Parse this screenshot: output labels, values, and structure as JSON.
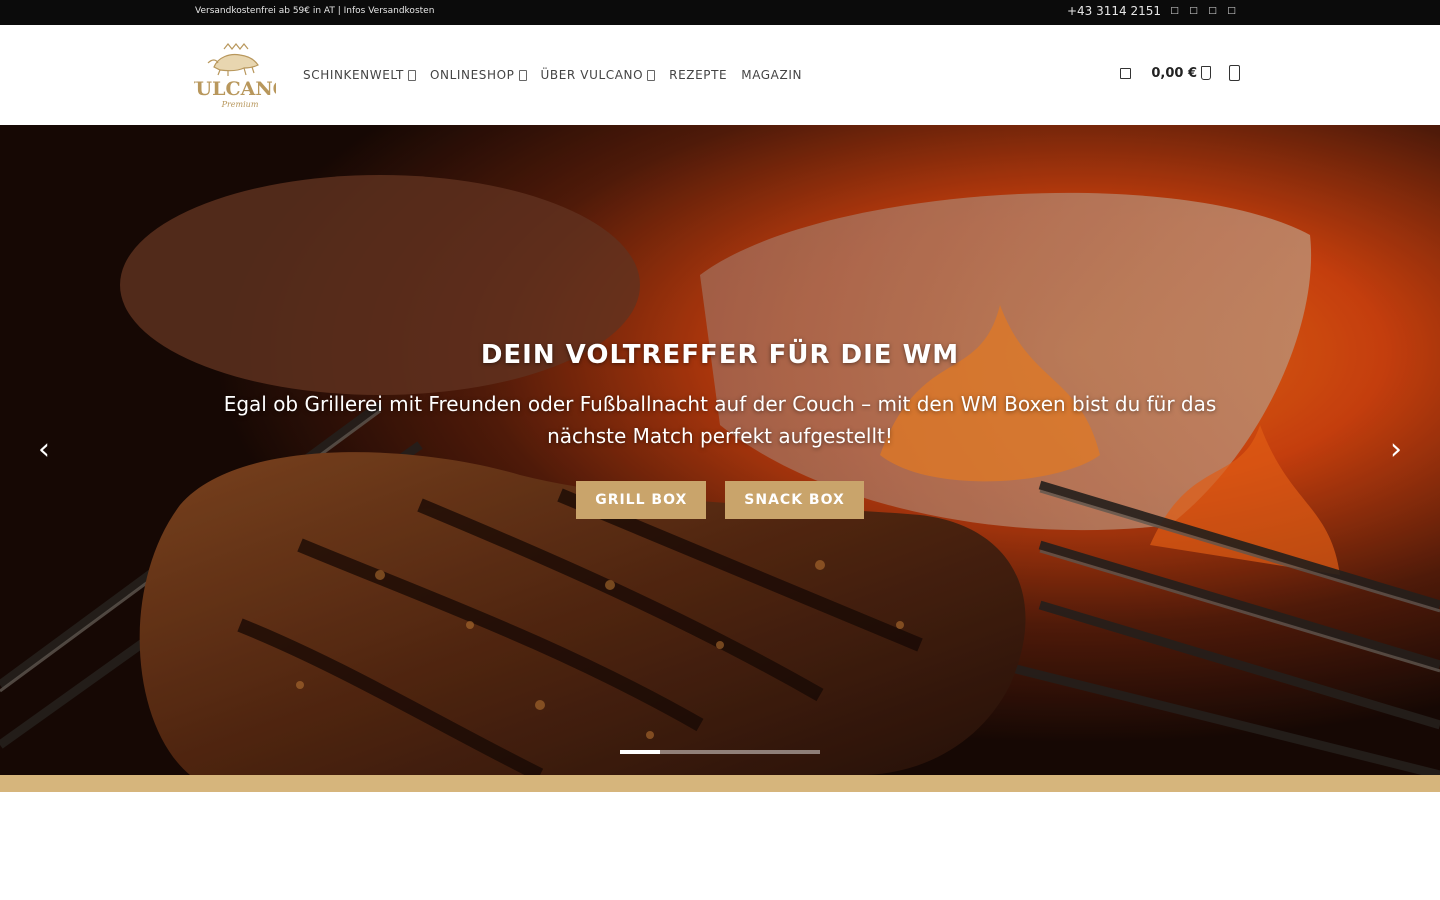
{
  "topbar": {
    "shipping_text": "Versandkostenfrei ab 59€ in AT | Infos Versandkosten",
    "phone": "+43 3114 2151",
    "icons": [
      "facebook-icon",
      "instagram-icon",
      "pinterest-icon",
      "email-icon"
    ]
  },
  "header": {
    "logo": {
      "name": "VULCANO",
      "tagline": "Premium"
    },
    "nav": [
      {
        "label": "SCHINKENWELT",
        "has_dropdown": true
      },
      {
        "label": "ONLINESHOP",
        "has_dropdown": true
      },
      {
        "label": "ÜBER VULCANO",
        "has_dropdown": true
      },
      {
        "label": "REZEPTE",
        "has_dropdown": false
      },
      {
        "label": "MAGAZIN",
        "has_dropdown": false
      }
    ],
    "cart_total": "0,00 €"
  },
  "hero": {
    "title": "DEIN VOLTREFFER FÜR DIE WM",
    "subtitle": "Egal ob Grillerei mit Freunden oder Fußballnacht auf der Couch – mit den WM Boxen bist du für das nächste Match perfekt aufgestellt!",
    "buttons": [
      {
        "label": "GRILL BOX"
      },
      {
        "label": "SNACK BOX"
      }
    ],
    "slides_count": 5,
    "active_slide": 1
  },
  "colors": {
    "accent_gold": "#c9a46b",
    "band_gold": "#d6b57c",
    "topbar_bg": "#0b0b0b"
  }
}
